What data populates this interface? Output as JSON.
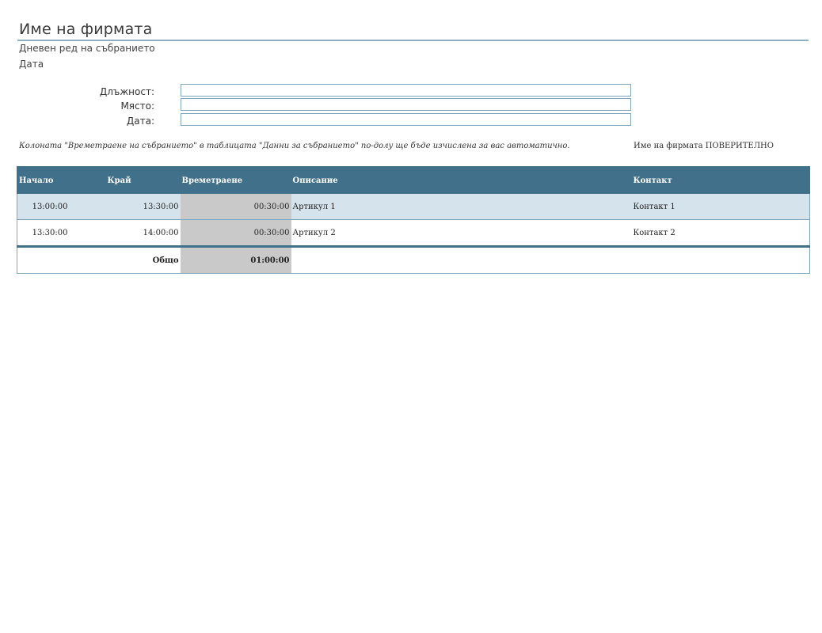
{
  "header": {
    "company_name": "Име на фирмата",
    "subtitle": "Дневен ред на събранието",
    "date": "Дата"
  },
  "fields": [
    {
      "label": "Длъжност:",
      "value": ""
    },
    {
      "label": "Място:",
      "value": ""
    },
    {
      "label": "Дата:",
      "value": ""
    }
  ],
  "note": "Колоната \"Времетраене на събранието\" в таблицата \"Данни за събранието\" по-долу ще бъде изчислена за вас автоматично.",
  "confidential": "Име на фирмата ПОВЕРИТЕЛНО",
  "table": {
    "columns": [
      "Начало",
      "Край",
      "Времетраене",
      "Описание",
      "Контакт"
    ],
    "rows": [
      {
        "start": "13:00:00",
        "end": "13:30:00",
        "duration": "00:30:00",
        "description": "Артикул 1",
        "contact": "Контакт 1"
      },
      {
        "start": "13:30:00",
        "end": "14:00:00",
        "duration": "00:30:00",
        "description": "Артикул 2",
        "contact": "Контакт 2"
      }
    ],
    "total_label": "Общо",
    "total_duration": "01:00:00"
  },
  "colors": {
    "header_fill": "#41708a",
    "shaded_row": "#d5e3ec",
    "duration_fill": "#c9c9c9",
    "border": "#7fa6bd"
  }
}
